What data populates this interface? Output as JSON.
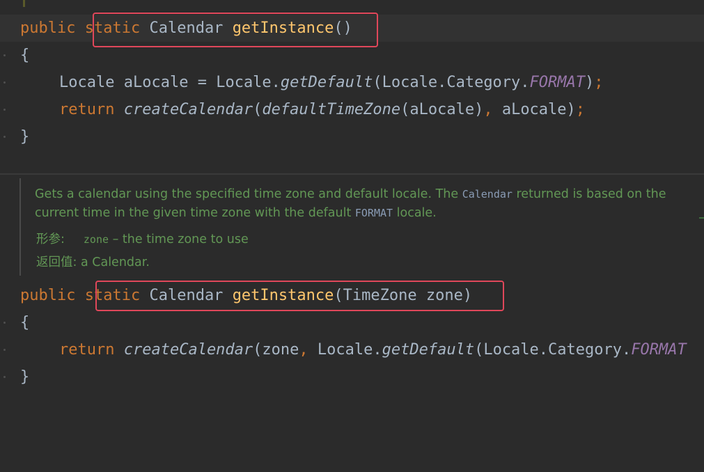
{
  "editor": {
    "method1": {
      "signature": {
        "public": "public",
        "static": "static",
        "return_type": "Calendar",
        "name": "getInstance",
        "params": "()"
      },
      "open_brace": "{",
      "line1": {
        "type": "Locale",
        "var": "aLocale",
        "eq": "=",
        "cls": "Locale.",
        "call": "getDefault",
        "arg_prefix": "(Locale.Category.",
        "arg_const": "FORMAT",
        "close": ")",
        "semi": ";"
      },
      "line2": {
        "return": "return",
        "call": "createCalendar",
        "open": "(",
        "inner_call": "defaultTimeZone",
        "inner_args": "(aLocale)",
        "comma": ",",
        "arg2": " aLocale)",
        "semi": ";"
      },
      "close_brace": "}"
    },
    "javadoc": {
      "text_part1": "Gets a calendar using the specified time zone and default locale. The ",
      "code1": "Calendar",
      "text_part2": " returned is based on the current time in the given time zone with the default ",
      "code2": "FORMAT",
      "text_part3": " locale.",
      "params_label": "形参:",
      "param_name": "zone",
      "param_desc": " – the time zone to use",
      "returns_label": "返回值:",
      "returns_desc": " a Calendar."
    },
    "method2": {
      "signature": {
        "public": "public",
        "static": "static",
        "return_type": "Calendar",
        "name": "getInstance",
        "params": "(TimeZone zone)"
      },
      "open_brace": "{",
      "line1": {
        "return": "return",
        "call": "createCalendar",
        "args_prefix": "(zone",
        "comma": ",",
        "cls": " Locale.",
        "inner_call": "getDefault",
        "arg_prefix": "(Locale.Category.",
        "arg_const": "FORMAT"
      },
      "close_brace": "}"
    }
  },
  "colors": {
    "background": "#2b2b2b",
    "keyword": "#cc7832",
    "method": "#ffc66d",
    "constant": "#9876aa",
    "javadoc": "#629755",
    "highlight_box": "#e0475a"
  }
}
